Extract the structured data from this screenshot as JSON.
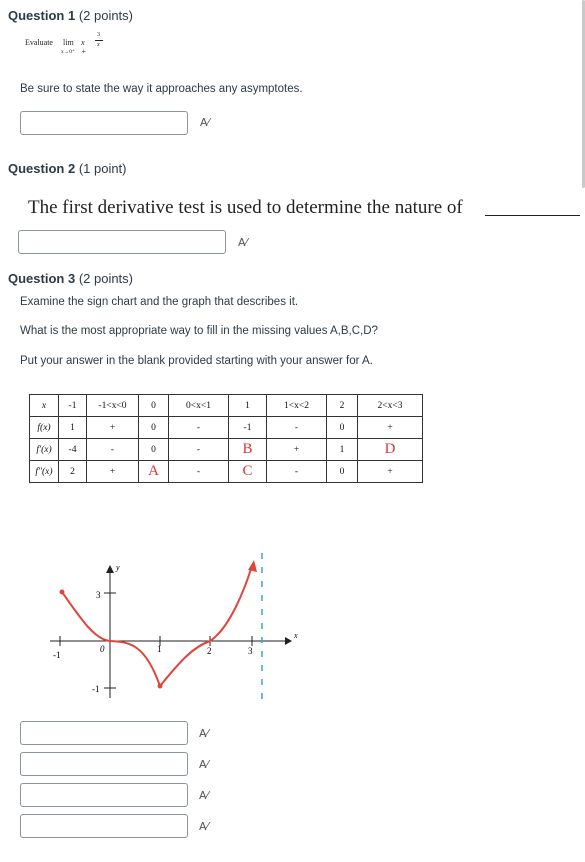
{
  "q1": {
    "title": "Question 1",
    "points": "(2 points)",
    "evaluate": "Evaluate",
    "lim": "lim",
    "approach": "x→0⁺",
    "expr": "x +",
    "frac_num": "3",
    "frac_den": "x",
    "instruction": "Be sure to state the way it approaches any asymptotes."
  },
  "q2": {
    "title": "Question 2",
    "points": "(1 point)",
    "prompt": "The first derivative test is used to determine the nature of"
  },
  "q3": {
    "title": "Question 3",
    "points": "(2 points)",
    "line1": "Examine the sign chart and the graph that describes it.",
    "line2": "What is the most appropriate way to fill in the missing values A,B,C,D?",
    "line3": "Put your answer in the blank provided starting with your answer for A.",
    "table": {
      "header": [
        "x",
        "-1",
        "-1<x<0",
        "0",
        "0<x<1",
        "1",
        "1<x<2",
        "2",
        "2<x<3"
      ],
      "rows": [
        [
          "f(x)",
          "1",
          "+",
          "0",
          "-",
          "-1",
          "-",
          "0",
          "+"
        ],
        [
          "f′(x)",
          "-4",
          "-",
          "0",
          "-",
          "B",
          "+",
          "1",
          "D"
        ],
        [
          "f″(x)",
          "2",
          "+",
          "A",
          "-",
          "C",
          "-",
          "0",
          "+"
        ]
      ]
    },
    "graph": {
      "y_axis": "y",
      "x_axis": "x",
      "label_3": "3",
      "label_neg1_y": "-1",
      "label_neg1_x": "-1",
      "label_0": "0",
      "label_1": "1",
      "label_2": "2",
      "label_3x": "3"
    }
  },
  "spellcheck_icon": "spellcheck-icon",
  "colors": {
    "curve": "#e0443a",
    "asymptote": "#3aa8b8"
  }
}
